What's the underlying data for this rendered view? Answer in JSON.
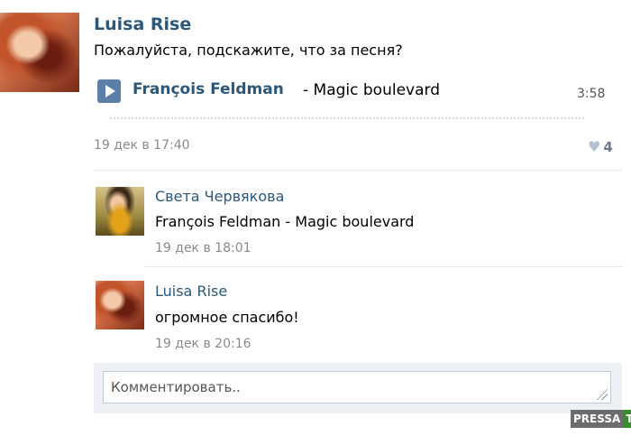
{
  "post": {
    "author": "Luisa Rise",
    "text": "Пожалуйста, подскажите, что за песня?",
    "audio": {
      "artist": "François Feldman",
      "separator_title": "- Magic boulevard",
      "duration": "3:58"
    },
    "date": "19 дек в 17:40",
    "likes": "4"
  },
  "comments": [
    {
      "author": "Света Червякова",
      "text": "François Feldman - Magic boulevard",
      "date": "19 дек в 18:01"
    },
    {
      "author": "Luisa Rise",
      "text": "огромное спасибо!",
      "date": "19 дек в 20:16"
    }
  ],
  "comment_input": {
    "placeholder": "Комментировать.."
  },
  "watermark": {
    "part1": "PRESSA",
    "part2": "TV"
  },
  "colors": {
    "link": "#2b587a",
    "play_button": "#5b7fa6",
    "muted": "#8a8a8a"
  }
}
